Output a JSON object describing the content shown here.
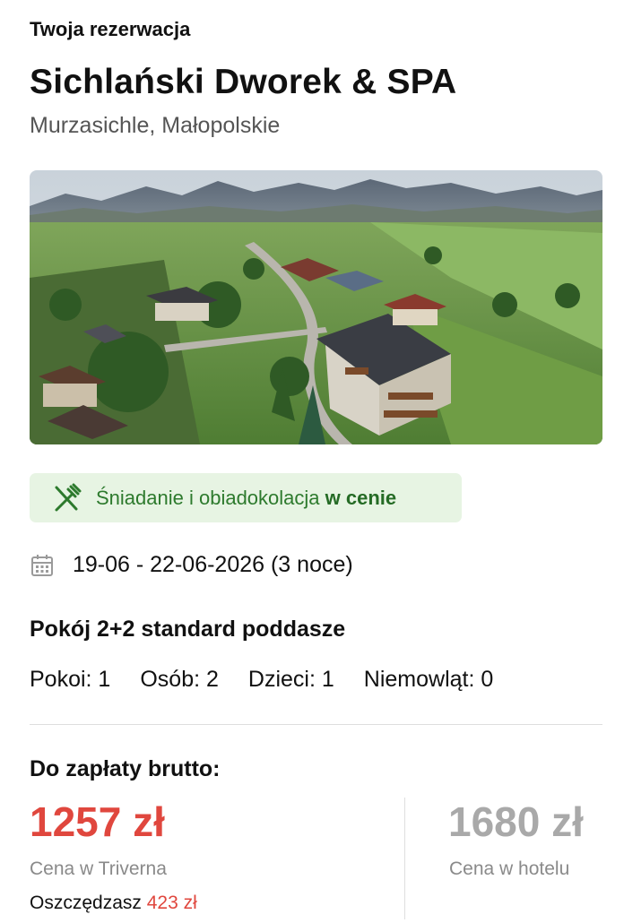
{
  "header": {
    "kicker": "Twoja rezerwacja",
    "hotel_name": "Sichlański Dworek & SPA",
    "location": "Murzasichle, Małopolskie"
  },
  "photo": {
    "alt": "Widok z lotu ptaka na hotel w Murzasichle z panoramą Tatr"
  },
  "meal_badge": {
    "text": "Śniadanie i obiadokolacja",
    "emphasis": "w cenie",
    "icon": "fork-knife-icon",
    "bg_color": "#e7f4e3",
    "text_color": "#2d7a2d"
  },
  "stay": {
    "dates": "19-06 - 22-06-2026 (3 noce)",
    "icon": "calendar-icon"
  },
  "room": {
    "name": "Pokój 2+2 standard poddasze",
    "occupancy": [
      "Pokoi: 1",
      "Osób: 2",
      "Dzieci: 1",
      "Niemowląt: 0"
    ]
  },
  "payment": {
    "label": "Do zapłaty brutto:",
    "price_triverna": "1257 zł",
    "price_triverna_label": "Cena w Triverna",
    "price_hotel": "1680 zł",
    "price_hotel_label": "Cena w hotelu",
    "savings_prefix": "Oszczędzasz",
    "savings_amount": "423 zł",
    "accent_color": "#e0473e"
  }
}
